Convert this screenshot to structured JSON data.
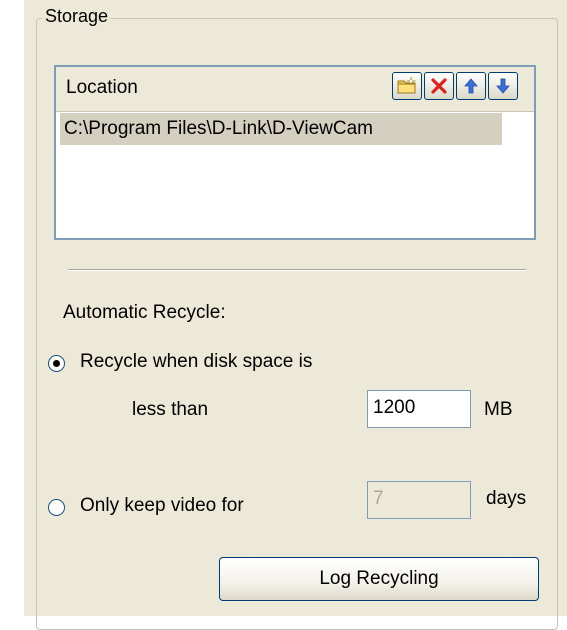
{
  "storage": {
    "group_title": "Storage",
    "location_header": "Location",
    "toolbar": {
      "add_icon": "folder-add-icon",
      "delete_icon": "delete-x-icon",
      "move_up_icon": "arrow-up-icon",
      "move_down_icon": "arrow-down-icon"
    },
    "locations": [
      "C:\\Program Files\\D-Link\\D-ViewCam"
    ]
  },
  "recycle": {
    "heading": "Automatic Recycle:",
    "option_space": {
      "label": "Recycle when disk space is",
      "sub_label": "less than",
      "value": "1200",
      "unit": "MB",
      "selected": true
    },
    "option_days": {
      "label": "Only keep video for",
      "value": "7",
      "unit": "days",
      "selected": false
    },
    "log_button": "Log Recycling"
  },
  "colors": {
    "panel_bg": "#ece9d8",
    "input_border": "#7f9db9",
    "selection_bg": "#d4d0c0"
  }
}
